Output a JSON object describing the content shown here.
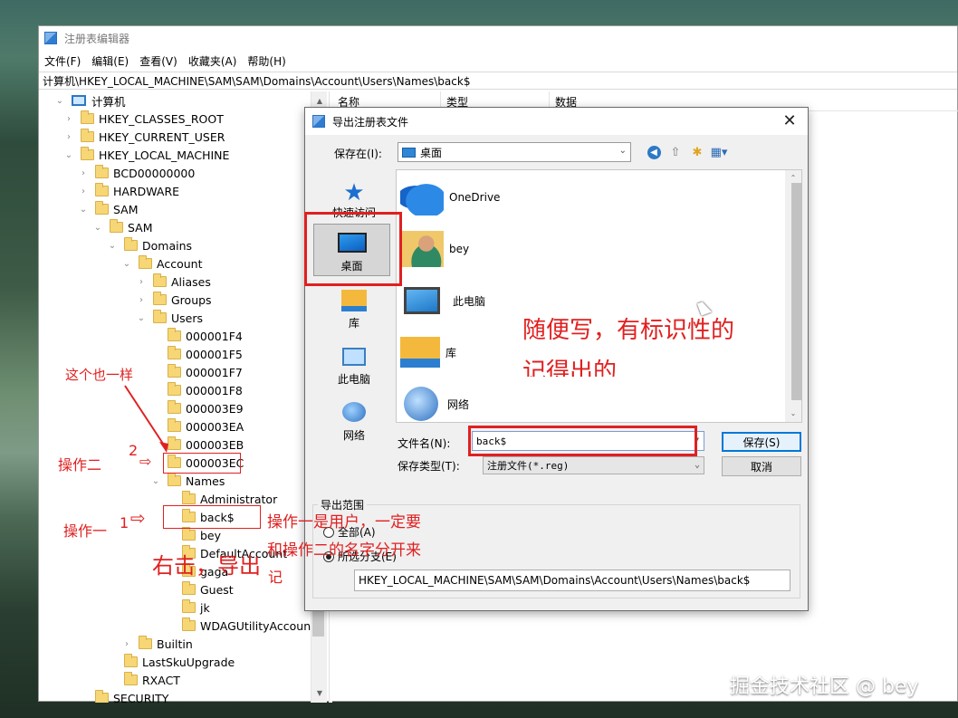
{
  "window": {
    "title": "注册表编辑器",
    "address": "计算机\\HKEY_LOCAL_MACHINE\\SAM\\SAM\\Domains\\Account\\Users\\Names\\back$"
  },
  "menu": [
    "文件(F)",
    "编辑(E)",
    "查看(V)",
    "收藏夹(A)",
    "帮助(H)"
  ],
  "list_columns": [
    "名称",
    "类型",
    "数据"
  ],
  "tree": {
    "root": "计算机",
    "items": [
      {
        "label": "HKEY_CLASSES_ROOT",
        "twist": "›"
      },
      {
        "label": "HKEY_CURRENT_USER",
        "twist": "›"
      },
      {
        "label": "HKEY_LOCAL_MACHINE",
        "twist": "⌄"
      },
      {
        "label": "BCD00000000",
        "twist": "›"
      },
      {
        "label": "HARDWARE",
        "twist": "›"
      },
      {
        "label": "SAM",
        "twist": "⌄"
      },
      {
        "label": "SAM",
        "twist": "⌄"
      },
      {
        "label": "Domains",
        "twist": "⌄"
      },
      {
        "label": "Account",
        "twist": "⌄"
      },
      {
        "label": "Aliases",
        "twist": "›"
      },
      {
        "label": "Groups",
        "twist": "›"
      },
      {
        "label": "Users",
        "twist": "⌄"
      },
      {
        "label": "000001F4",
        "twist": ""
      },
      {
        "label": "000001F5",
        "twist": ""
      },
      {
        "label": "000001F7",
        "twist": ""
      },
      {
        "label": "000001F8",
        "twist": ""
      },
      {
        "label": "000003E9",
        "twist": ""
      },
      {
        "label": "000003EA",
        "twist": ""
      },
      {
        "label": "000003EB",
        "twist": ""
      },
      {
        "label": "000003EC",
        "twist": ""
      },
      {
        "label": "Names",
        "twist": "⌄"
      },
      {
        "label": "Administrator",
        "twist": ""
      },
      {
        "label": "back$",
        "twist": ""
      },
      {
        "label": "bey",
        "twist": ""
      },
      {
        "label": "DefaultAccount",
        "twist": ""
      },
      {
        "label": "gaga",
        "twist": ""
      },
      {
        "label": "Guest",
        "twist": ""
      },
      {
        "label": "jk",
        "twist": ""
      },
      {
        "label": "WDAGUtilityAccount",
        "twist": ""
      },
      {
        "label": "Builtin",
        "twist": "›"
      },
      {
        "label": "LastSkuUpgrade",
        "twist": ""
      },
      {
        "label": "RXACT",
        "twist": ""
      },
      {
        "label": "SECURITY",
        "twist": ""
      }
    ]
  },
  "dialog": {
    "title": "导出注册表文件",
    "close": "✕",
    "save_in_label": "保存在(I):",
    "save_in_value": "桌面",
    "places": [
      "快速访问",
      "桌面",
      "库",
      "此电脑",
      "网络"
    ],
    "files": [
      "OneDrive",
      "bey",
      "此电脑",
      "库",
      "网络"
    ],
    "filename_label": "文件名(N):",
    "filename_value": "back$",
    "filetype_label": "保存类型(T):",
    "filetype_value": "注册文件(*.reg)",
    "save_button": "保存(S)",
    "cancel_button": "取消",
    "range_title": "导出范围",
    "range_all": "全部(A)",
    "range_branch": "所选分支(E)",
    "branch_path": "HKEY_LOCAL_MACHINE\\SAM\\SAM\\Domains\\Account\\Users\\Names\\back$"
  },
  "annotations": {
    "same_note": "这个也一样",
    "op2": "操作二",
    "num2": "2",
    "op1": "操作一",
    "num1": "1",
    "right_click": "右击，导出",
    "ji": "记",
    "op1_note1": "操作一是用户，一定要",
    "op1_note2": "和操作二的名字分开来",
    "write_note1": "随便写，有标识性的",
    "write_note2": "记得出的"
  },
  "watermark": "掘金技术社区 @ bey"
}
